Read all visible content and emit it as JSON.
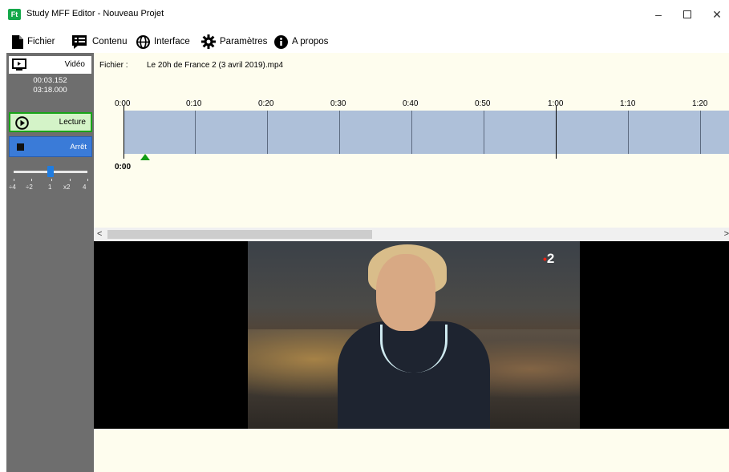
{
  "window": {
    "title": "Study MFF Editor - Nouveau Projet",
    "logo_text": "Ft",
    "minimize_glyph": "–",
    "close_glyph": "✕"
  },
  "menu": {
    "items": [
      {
        "label": "Fichier",
        "icon": "file-icon"
      },
      {
        "label": "Contenu",
        "icon": "content-list-icon"
      },
      {
        "label": "Interface",
        "icon": "globe-icon"
      },
      {
        "label": "Paramètres",
        "icon": "gear-icon"
      },
      {
        "label": "A propos",
        "icon": "info-icon"
      }
    ]
  },
  "left_panel": {
    "video_label": "Vidéo",
    "current_time": "00:03.152",
    "total_time": "03:18.000",
    "play_label": "Lecture",
    "stop_label": "Arrêt",
    "speed_labels": [
      "÷4",
      "÷2",
      "1",
      "x2",
      "4"
    ],
    "speed_selected_index": 2,
    "colors": {
      "play_bg": "#d4f3c8",
      "play_border": "#18a418",
      "stop_bg": "#3a7bd8"
    }
  },
  "main": {
    "file_label": "Fichier :",
    "file_name": "Le 20h de France 2 (3 avril 2019).mp4",
    "ruler_labels": [
      "0:00",
      "0:10",
      "0:20",
      "0:30",
      "0:40",
      "0:50",
      "1:00",
      "1:10",
      "1:20"
    ],
    "position_label": "0:00",
    "track_color": "#aec0d9",
    "marker_color": "#149c14",
    "scroll_left": "<",
    "scroll_right": ">",
    "video": {
      "channel_logo": "2"
    }
  }
}
